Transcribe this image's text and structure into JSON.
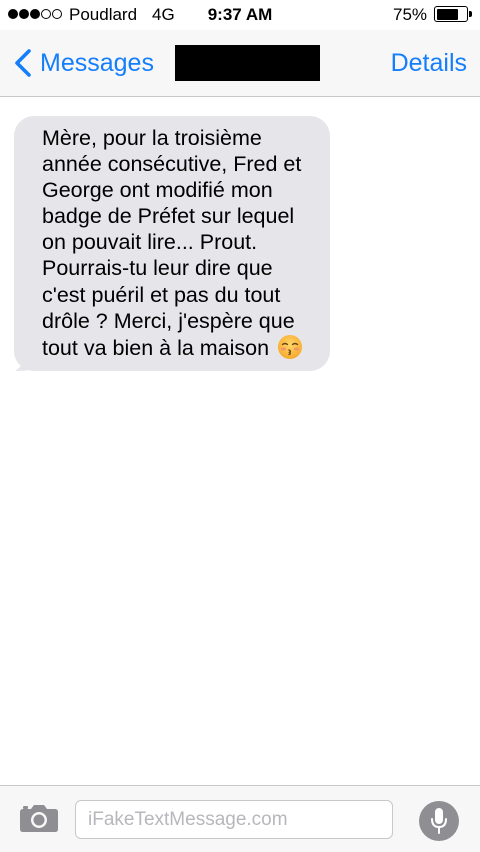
{
  "status_bar": {
    "signal_bars_filled": 3,
    "signal_bars_total": 5,
    "carrier": "Poudlard",
    "network": "4G",
    "time": "9:37 AM",
    "battery_percent": "75%",
    "battery_level": 0.75
  },
  "nav": {
    "back_label": "Messages",
    "details_label": "Details",
    "accent_color": "#157efb"
  },
  "messages": [
    {
      "direction": "received",
      "text": "Mère, pour la troisième année consécutive, Fred et George ont modifié mon badge de Préfet sur lequel on pouvait lire... Prout. Pourrais-tu leur dire que c'est puéril et pas du tout drôle ? Merci, j'espère que tout va bien à la maison",
      "trailing_emoji": "kissing-face-with-closed-eyes"
    }
  ],
  "input": {
    "placeholder": "iFakeTextMessage.com",
    "value": ""
  }
}
